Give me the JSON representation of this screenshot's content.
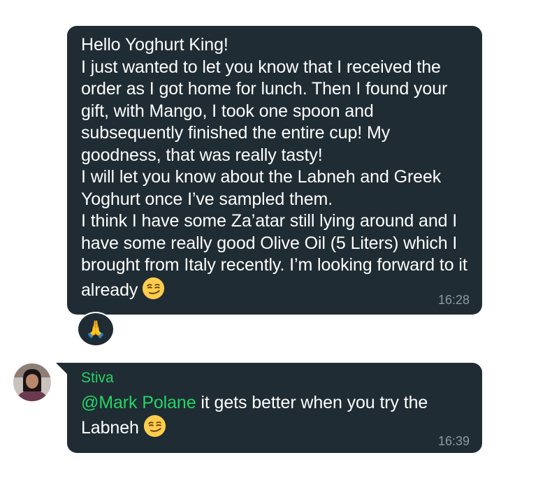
{
  "messages": [
    {
      "text": "Hello Yoghurt King!\nI just wanted to let you know that I received the order as I got home for lunch. Then I found your gift, with Mango, I took one spoon and subsequently finished the entire cup! My goodness, that was really tasty!\nI will let you know about the Labneh and Greek Yoghurt once I’ve sampled them.\nI think I have some Za’atar still lying around and I have some really good Olive Oil (5 Liters) which I brought from Italy recently. I’m looking forward to it already",
      "emoji": "smirking-face-emoji",
      "time": "16:28",
      "reaction": "🙏"
    },
    {
      "sender": "Stiva",
      "mention": "@Mark Polane",
      "text": " it gets better when you try the Labneh",
      "emoji": "smirking-face-emoji",
      "time": "16:39"
    }
  ],
  "colors": {
    "bubble_bg": "#1f2c33",
    "text": "#ffffff",
    "timestamp": "#8e9aa1",
    "sender_name": "#25d366",
    "mention": "#25d366"
  },
  "icons": {
    "reaction": "folded-hands-emoji",
    "avatar": "user-avatar"
  }
}
